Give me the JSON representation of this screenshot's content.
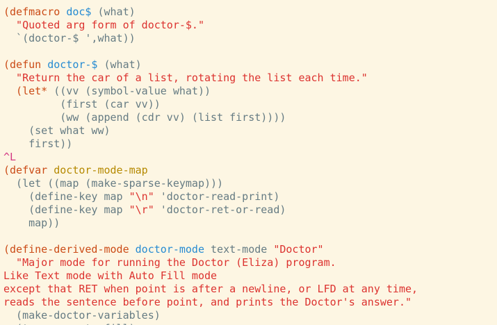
{
  "editor": {
    "mode": "emacs-lisp",
    "theme": {
      "background": "#fdf6e3",
      "default": "#657b83",
      "keyword": "#cb4b16",
      "function": "#268bd2",
      "string": "#dc322f",
      "variable": "#b58900",
      "control": "#d33682"
    },
    "lines": [
      [
        [
          "keyword",
          "(defmacro "
        ],
        [
          "function",
          "doc$"
        ],
        [
          "default",
          " (what)"
        ]
      ],
      [
        [
          "string",
          "  \"Quoted arg form of doctor-$.\""
        ]
      ],
      [
        [
          "default",
          "  `(doctor-$ ',what))"
        ]
      ],
      [],
      [
        [
          "keyword",
          "(defun "
        ],
        [
          "function",
          "doctor-$"
        ],
        [
          "default",
          " (what)"
        ]
      ],
      [
        [
          "string",
          "  \"Return the car of a list, rotating the list each time.\""
        ]
      ],
      [
        [
          "keyword",
          "  (let* "
        ],
        [
          "default",
          "((vv (symbol-value what))"
        ]
      ],
      [
        [
          "default",
          "         (first (car vv))"
        ]
      ],
      [
        [
          "default",
          "         (ww (append (cdr vv) (list first))))"
        ]
      ],
      [
        [
          "default",
          "    (set what ww)"
        ]
      ],
      [
        [
          "default",
          "    first))"
        ]
      ],
      [
        [
          "control",
          "^L"
        ]
      ],
      [
        [
          "keyword",
          "(defvar "
        ],
        [
          "variable",
          "doctor-mode-map"
        ]
      ],
      [
        [
          "default",
          "  (let ((map (make-sparse-keymap)))"
        ]
      ],
      [
        [
          "default",
          "    (define-key map "
        ],
        [
          "string",
          "\"\\n\""
        ],
        [
          "default",
          " 'doctor-read-print)"
        ]
      ],
      [
        [
          "default",
          "    (define-key map "
        ],
        [
          "string",
          "\"\\r\""
        ],
        [
          "default",
          " 'doctor-ret-or-read)"
        ]
      ],
      [
        [
          "default",
          "    map))"
        ]
      ],
      [],
      [
        [
          "keyword",
          "(define-derived-mode "
        ],
        [
          "function",
          "doctor-mode"
        ],
        [
          "default",
          " text-mode "
        ],
        [
          "string",
          "\"Doctor\""
        ]
      ],
      [
        [
          "string",
          "  \"Major mode for running the Doctor (Eliza) program."
        ]
      ],
      [
        [
          "string",
          "Like Text mode with Auto Fill mode"
        ]
      ],
      [
        [
          "string",
          "except that RET when point is after a newline, or LFD at any time,"
        ]
      ],
      [
        [
          "string",
          "reads the sentence before point, and prints the Doctor's answer.\""
        ]
      ],
      [
        [
          "default",
          "  (make-doctor-variables)"
        ]
      ],
      [
        [
          "default",
          "  (turn-on-auto-fill)"
        ]
      ]
    ]
  }
}
